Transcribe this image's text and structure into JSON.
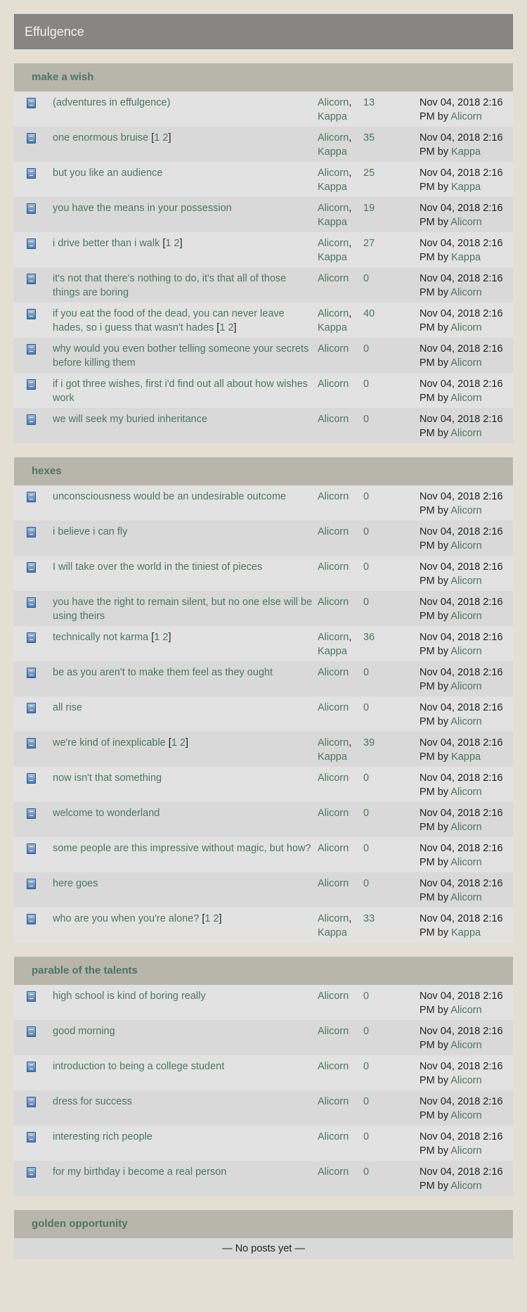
{
  "site": {
    "title": "Effulgence"
  },
  "categories": [
    {
      "name": "make a wish",
      "threads": [
        {
          "title": "(adventures in effulgence)",
          "pages": [],
          "authors": [
            "Alicorn",
            "Kappa"
          ],
          "count": "13",
          "date": "Nov 04, 2018 2:16 PM",
          "by": "Alicorn"
        },
        {
          "title": "one enormous bruise",
          "pages": [
            "1",
            "2"
          ],
          "authors": [
            "Alicorn",
            "Kappa"
          ],
          "count": "35",
          "date": "Nov 04, 2018 2:16 PM",
          "by": "Kappa"
        },
        {
          "title": "but you like an audience",
          "pages": [],
          "authors": [
            "Alicorn",
            "Kappa"
          ],
          "count": "25",
          "date": "Nov 04, 2018 2:16 PM",
          "by": "Kappa"
        },
        {
          "title": "you have the means in your possession",
          "pages": [],
          "authors": [
            "Alicorn",
            "Kappa"
          ],
          "count": "19",
          "date": "Nov 04, 2018 2:16 PM",
          "by": "Alicorn"
        },
        {
          "title": "i drive better than i walk",
          "pages": [
            "1",
            "2"
          ],
          "authors": [
            "Alicorn",
            "Kappa"
          ],
          "count": "27",
          "date": "Nov 04, 2018 2:16 PM",
          "by": "Kappa"
        },
        {
          "title": "it's not that there's nothing to do, it's that all of those things are boring",
          "pages": [],
          "authors": [
            "Alicorn"
          ],
          "count": "0",
          "date": "Nov 04, 2018 2:16 PM",
          "by": "Alicorn"
        },
        {
          "title": "if you eat the food of the dead, you can never leave hades, so i guess that wasn't hades",
          "pages": [
            "1",
            "2"
          ],
          "authors": [
            "Alicorn",
            "Kappa"
          ],
          "count": "40",
          "date": "Nov 04, 2018 2:16 PM",
          "by": "Alicorn"
        },
        {
          "title": "why would you even bother telling someone your secrets before killing them",
          "pages": [],
          "authors": [
            "Alicorn"
          ],
          "count": "0",
          "date": "Nov 04, 2018 2:16 PM",
          "by": "Alicorn"
        },
        {
          "title": "if i got three wishes, first i'd find out all about how wishes work",
          "pages": [],
          "authors": [
            "Alicorn"
          ],
          "count": "0",
          "date": "Nov 04, 2018 2:16 PM",
          "by": "Alicorn"
        },
        {
          "title": "we will seek my buried inheritance",
          "pages": [],
          "authors": [
            "Alicorn"
          ],
          "count": "0",
          "date": "Nov 04, 2018 2:16 PM",
          "by": "Alicorn"
        }
      ]
    },
    {
      "name": "hexes",
      "threads": [
        {
          "title": "unconsciousness would be an undesirable outcome",
          "pages": [],
          "authors": [
            "Alicorn"
          ],
          "count": "0",
          "date": "Nov 04, 2018 2:16 PM",
          "by": "Alicorn"
        },
        {
          "title": "i believe i can fly",
          "pages": [],
          "authors": [
            "Alicorn"
          ],
          "count": "0",
          "date": "Nov 04, 2018 2:16 PM",
          "by": "Alicorn"
        },
        {
          "title": "I will take over the world in the tiniest of pieces",
          "pages": [],
          "authors": [
            "Alicorn"
          ],
          "count": "0",
          "date": "Nov 04, 2018 2:16 PM",
          "by": "Alicorn"
        },
        {
          "title": "you have the right to remain silent, but no one else will be using theirs",
          "pages": [],
          "authors": [
            "Alicorn"
          ],
          "count": "0",
          "date": "Nov 04, 2018 2:16 PM",
          "by": "Alicorn"
        },
        {
          "title": "technically not karma",
          "pages": [
            "1",
            "2"
          ],
          "authors": [
            "Alicorn",
            "Kappa"
          ],
          "count": "36",
          "date": "Nov 04, 2018 2:16 PM",
          "by": "Alicorn"
        },
        {
          "title": "be as you aren't to make them feel as they ought",
          "pages": [],
          "authors": [
            "Alicorn"
          ],
          "count": "0",
          "date": "Nov 04, 2018 2:16 PM",
          "by": "Alicorn"
        },
        {
          "title": "all rise",
          "pages": [],
          "authors": [
            "Alicorn"
          ],
          "count": "0",
          "date": "Nov 04, 2018 2:16 PM",
          "by": "Alicorn"
        },
        {
          "title": "we're kind of inexplicable",
          "pages": [
            "1",
            "2"
          ],
          "authors": [
            "Alicorn",
            "Kappa"
          ],
          "count": "39",
          "date": "Nov 04, 2018 2:16 PM",
          "by": "Kappa"
        },
        {
          "title": "now isn't that something",
          "pages": [],
          "authors": [
            "Alicorn"
          ],
          "count": "0",
          "date": "Nov 04, 2018 2:16 PM",
          "by": "Alicorn"
        },
        {
          "title": "welcome to wonderland",
          "pages": [],
          "authors": [
            "Alicorn"
          ],
          "count": "0",
          "date": "Nov 04, 2018 2:16 PM",
          "by": "Alicorn"
        },
        {
          "title": "some people are this impressive without magic, but how?",
          "pages": [],
          "authors": [
            "Alicorn"
          ],
          "count": "0",
          "date": "Nov 04, 2018 2:16 PM",
          "by": "Alicorn"
        },
        {
          "title": "here goes",
          "pages": [],
          "authors": [
            "Alicorn"
          ],
          "count": "0",
          "date": "Nov 04, 2018 2:16 PM",
          "by": "Alicorn"
        },
        {
          "title": "who are you when you're alone?",
          "pages": [
            "1",
            "2"
          ],
          "authors": [
            "Alicorn",
            "Kappa"
          ],
          "count": "33",
          "date": "Nov 04, 2018 2:16 PM",
          "by": "Kappa"
        }
      ]
    },
    {
      "name": "parable of the talents",
      "threads": [
        {
          "title": "high school is kind of boring really",
          "pages": [],
          "authors": [
            "Alicorn"
          ],
          "count": "0",
          "date": "Nov 04, 2018 2:16 PM",
          "by": "Alicorn"
        },
        {
          "title": "good morning",
          "pages": [],
          "authors": [
            "Alicorn"
          ],
          "count": "0",
          "date": "Nov 04, 2018 2:16 PM",
          "by": "Alicorn"
        },
        {
          "title": "introduction to being a college student",
          "pages": [],
          "authors": [
            "Alicorn"
          ],
          "count": "0",
          "date": "Nov 04, 2018 2:16 PM",
          "by": "Alicorn"
        },
        {
          "title": "dress for success",
          "pages": [],
          "authors": [
            "Alicorn"
          ],
          "count": "0",
          "date": "Nov 04, 2018 2:16 PM",
          "by": "Alicorn"
        },
        {
          "title": "interesting rich people",
          "pages": [],
          "authors": [
            "Alicorn"
          ],
          "count": "0",
          "date": "Nov 04, 2018 2:16 PM",
          "by": "Alicorn"
        },
        {
          "title": "for my birthday i become a real person",
          "pages": [],
          "authors": [
            "Alicorn"
          ],
          "count": "0",
          "date": "Nov 04, 2018 2:16 PM",
          "by": "Alicorn"
        }
      ]
    },
    {
      "name": "golden opportunity",
      "threads": [],
      "empty_text": "— No posts yet —"
    }
  ],
  "labels": {
    "by": "by"
  },
  "icons": {
    "thread": "thread-page-icon"
  },
  "colors": {
    "link": "#4b7760",
    "header_bg": "#888585",
    "category_bg": "#b8b5ab",
    "row_odd": "#e2e2e2",
    "row_even": "#d9d9d9",
    "page_bg": "#e4dfd2"
  }
}
